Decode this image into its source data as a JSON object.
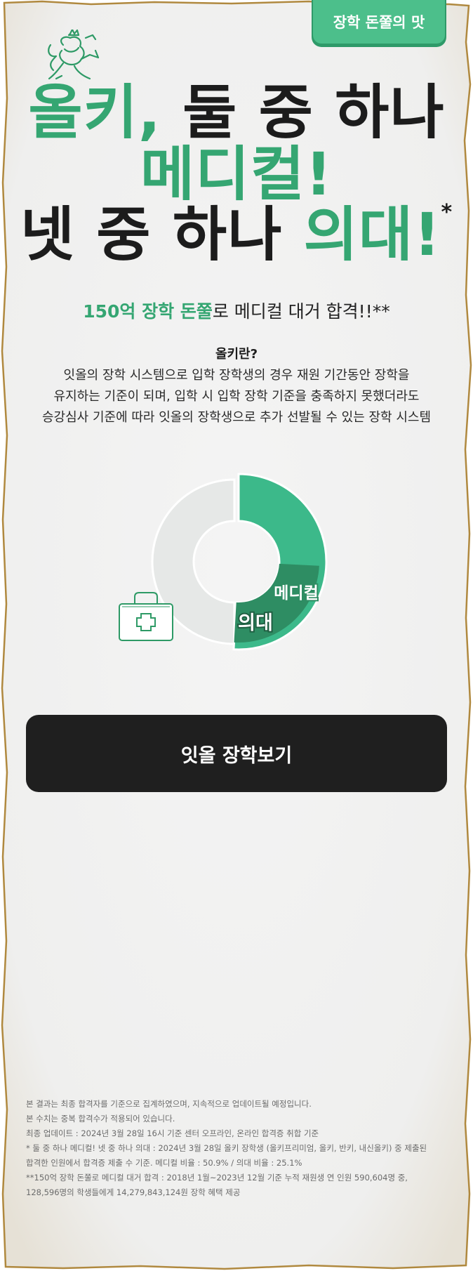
{
  "tag": {
    "label": "장학 돈쭐의 맛"
  },
  "headline": {
    "line1_green": "올키,",
    "line1_dark": "둘 중 하나",
    "line2": "메디컬!",
    "line3_dark": "넷 중 하나",
    "line3_green": "의대!",
    "line3_star": "*"
  },
  "subheadline": {
    "highlight": "150억 장학 돈쭐",
    "rest": "로 메디컬 대거 합격!!**"
  },
  "definition": {
    "title": "올키란?",
    "line1": "잇올의 장학 시스템으로 입학 장학생의 경우 재원 기간동안 장학을",
    "line2": "유지하는 기준이 되며, 입학 시 입학 장학 기준을 충족하지 못했더라도",
    "line3": "승강심사 기준에 따라 잇올의 장학생으로 추가 선발될 수 있는 장학 시스템"
  },
  "chart_data": {
    "type": "pie",
    "categories": [
      "메디컬",
      "의대"
    ],
    "values": [
      50.9,
      25.1
    ],
    "labels": [
      "메디컬",
      "의대"
    ]
  },
  "colors": {
    "accent": "#3cb98a",
    "dark_green": "#2e8d63",
    "ring_gray": "#e6e8e7",
    "button": "#1f1f1f"
  },
  "cta": {
    "label": "잇올 장학보기"
  },
  "footnotes": [
    "본 결과는 최종 합격자를 기준으로 집계하였으며, 지속적으로 업데이트될 예정입니다.",
    "본 수치는 중복 합격수가 적용되어 있습니다.",
    "최종 업데이트 : 2024년 3월 28일 16시 기준 센터 오프라인, 온라인 합격증 취합 기준",
    "* 둘 중 하나 메디컬! 넷 중 하나 의대 : 2024년 3월 28일 올키 장학생 (올키프리미엄, 올키, 반키, 내신올키) 중 제출된",
    "합격한 인원에서 합격증 제출 수 기준. 메디컬 비율 : 50.9% / 의대 비율 : 25.1%",
    "**150억 장학 돈쭐로 메디컬 대거 합격 : 2018년 1월~2023년 12월 기준 누적 재원생 연 인원 590,604명 중,",
    "128,596명의 학생들에게 14,279,843,124원 장학 혜택 제공"
  ],
  "icons": {
    "logo": "lion-crest-icon",
    "medical_kit": "medical-kit-icon"
  }
}
